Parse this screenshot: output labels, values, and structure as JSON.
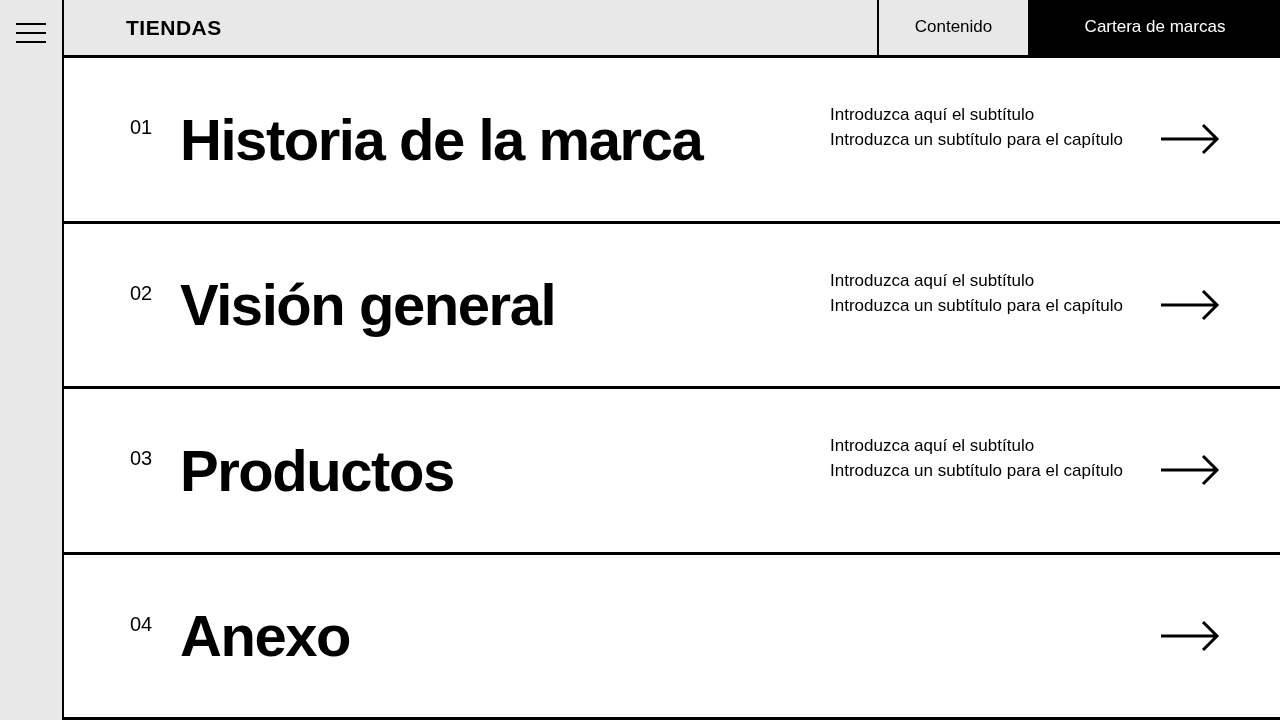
{
  "header": {
    "logo": "TIENDAS",
    "tabs": [
      {
        "label": "Contenido",
        "selected": false
      },
      {
        "label": "Cartera de marcas",
        "selected": true
      }
    ]
  },
  "chapters": [
    {
      "number": "01",
      "title": "Historia de la marca",
      "subtitles": [
        "Introduzca aquí el subtítulo",
        "Introduzca un subtítulo para el capítulo"
      ]
    },
    {
      "number": "02",
      "title": "Visión general",
      "subtitles": [
        "Introduzca aquí el subtítulo",
        "Introduzca un subtítulo para el capítulo"
      ]
    },
    {
      "number": "03",
      "title": "Productos",
      "subtitles": [
        "Introduzca aquí el subtítulo",
        "Introduzca un subtítulo para el capítulo"
      ]
    },
    {
      "number": "04",
      "title": "Anexo"
    }
  ]
}
